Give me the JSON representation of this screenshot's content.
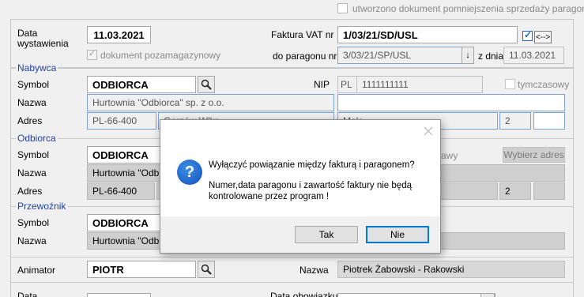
{
  "top": {
    "pomniejszenie_label": "utworzono dokument pomniejszenia sprzedaży paragonowej"
  },
  "header": {
    "data_wystawienia_label_1": "Data",
    "data_wystawienia_label_2": "wystawienia",
    "data_wystawienia_value": "11.03.2021",
    "dok_pozamag_label": "dokument pozamagazynowy",
    "faktura_label": "Faktura VAT nr",
    "faktura_value": "1/03/21/SD/USL",
    "link_btn_label": "<-->",
    "do_paragonu_label": "do paragonu nr",
    "do_paragonu_value": "3/03/21/SP/USL",
    "z_dnia_label": "z dnia",
    "z_dnia_value": "11.03.2021"
  },
  "nabywca": {
    "title": "Nabywca",
    "symbol_label": "Symbol",
    "symbol_value": "ODBIORCA",
    "nip_label": "NIP",
    "nip_prefix": "PL",
    "nip_value": "1111111111",
    "tymczasowy_label": "tymczasowy",
    "nazwa_label": "Nazwa",
    "nazwa_value": "Hurtownia \"Odbiorca\" sp. z o.o.",
    "adres_label": "Adres",
    "kod": "PL-66-400",
    "miasto": "Gorzów Wlkp.",
    "ulica": "Mała",
    "nr": "2"
  },
  "odbiorca": {
    "title": "Odbiorca",
    "symbol_label": "Symbol",
    "symbol_value": "ODBIORCA",
    "adres_dostawy_label": "awy",
    "wybierz_adres": "Wybierz adres",
    "nazwa_label": "Nazwa",
    "nazwa_value": "Hurtownia \"Odbi",
    "adres_label": "Adres",
    "kod": "PL-66-400",
    "nr": "2"
  },
  "przewoznik": {
    "title": "Przewoźnik",
    "symbol_label": "Symbol",
    "symbol_value": "ODBIORCA",
    "nazwa_label": "Nazwa",
    "nazwa_value": "Hurtownia \"Odbi"
  },
  "animator": {
    "label": "Animator",
    "value": "PIOTR",
    "nazwa_label": "Nazwa",
    "nazwa_value": "Piotrek Żabowski - Rakowski"
  },
  "bottom": {
    "data_label": "Data",
    "data_obowiazku_label": "Data obowiązku"
  },
  "dialog": {
    "message1": "Wyłączyć powiązanie między fakturą i paragonem?",
    "message2_line1": "Numer,data paragonu i zawartość faktury nie będą",
    "message2_line2": "kontrolowane przez program !",
    "yes_label": "Tak",
    "no_label": "Nie"
  }
}
